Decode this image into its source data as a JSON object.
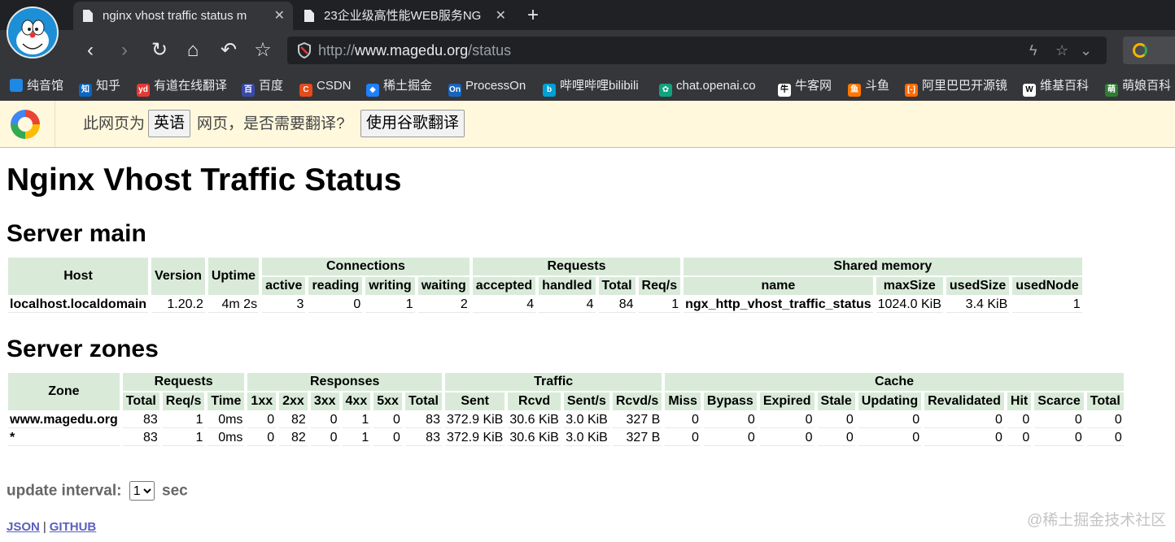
{
  "browser": {
    "tabs": [
      {
        "title": "nginx vhost traffic status m",
        "active": true
      },
      {
        "title": "23企业级高性能WEB服务NG",
        "active": false
      }
    ],
    "new_tab": "+",
    "url_prefix": "http://",
    "url_host": "www.magedu.org",
    "url_path": "/status",
    "bookmarks": [
      {
        "label": "纯音馆",
        "icon": "music-icon",
        "color": "#1e88e5"
      },
      {
        "label": "知乎",
        "icon": "zhihu-icon",
        "color": "#0a66c2",
        "glyph": "知"
      },
      {
        "label": "有道在线翻译",
        "icon": "youdao-icon",
        "color": "#e53935",
        "glyph": "yd"
      },
      {
        "label": "百度",
        "icon": "baidu-icon",
        "color": "#3949ab",
        "glyph": "百"
      },
      {
        "label": "CSDN",
        "icon": "csdn-icon",
        "color": "#e64a19",
        "glyph": "C"
      },
      {
        "label": "稀土掘金",
        "icon": "juejin-icon",
        "color": "#1e80ff",
        "glyph": "◆"
      },
      {
        "label": "ProcessOn",
        "icon": "processon-icon",
        "color": "#1565c0",
        "glyph": "On"
      },
      {
        "label": "哔哩哔哩bilibili",
        "icon": "bilibili-icon",
        "color": "#00a1d6",
        "glyph": "b"
      },
      {
        "label": "chat.openai.co",
        "icon": "openai-icon",
        "color": "#10a37f",
        "glyph": "✿"
      },
      {
        "label": "牛客网",
        "icon": "nowcoder-icon",
        "color": "#ffffff",
        "glyph": "牛"
      },
      {
        "label": "斗鱼",
        "icon": "douyu-icon",
        "color": "#ff7700",
        "glyph": "鱼"
      },
      {
        "label": "阿里巴巴开源镜",
        "icon": "aliyun-icon",
        "color": "#ff6a00",
        "glyph": "[-]"
      },
      {
        "label": "维基百科",
        "icon": "wikipedia-icon",
        "color": "#ffffff",
        "glyph": "W"
      },
      {
        "label": "萌娘百科",
        "icon": "moegirl-icon",
        "color": "#2e7d32",
        "glyph": "萌"
      }
    ],
    "translate_bar": {
      "prefix": "此网页为",
      "language": "英语",
      "suffix": "网页，是否需要翻译?",
      "button": "使用谷歌翻译"
    }
  },
  "page": {
    "title": "Nginx Vhost Traffic Status",
    "server_main": {
      "heading": "Server main",
      "headers": {
        "host": "Host",
        "version": "Version",
        "uptime": "Uptime",
        "connections": "Connections",
        "requests": "Requests",
        "shared_memory": "Shared memory",
        "conn_cols": [
          "active",
          "reading",
          "writing",
          "waiting"
        ],
        "req_cols": [
          "accepted",
          "handled",
          "Total",
          "Req/s"
        ],
        "shm_cols": [
          "name",
          "maxSize",
          "usedSize",
          "usedNode"
        ]
      },
      "row": {
        "host": "localhost.localdomain",
        "version": "1.20.2",
        "uptime": "4m 2s",
        "active": "3",
        "reading": "0",
        "writing": "1",
        "waiting": "2",
        "accepted": "4",
        "handled": "4",
        "total": "84",
        "reqs": "1",
        "shm_name": "ngx_http_vhost_traffic_status",
        "max_size": "1024.0 KiB",
        "used_size": "3.4 KiB",
        "used_node": "1"
      }
    },
    "server_zones": {
      "heading": "Server zones",
      "headers": {
        "zone": "Zone",
        "requests": "Requests",
        "responses": "Responses",
        "traffic": "Traffic",
        "cache": "Cache",
        "req_cols": [
          "Total",
          "Req/s",
          "Time"
        ],
        "resp_cols": [
          "1xx",
          "2xx",
          "3xx",
          "4xx",
          "5xx",
          "Total"
        ],
        "traffic_cols": [
          "Sent",
          "Rcvd",
          "Sent/s",
          "Rcvd/s"
        ],
        "cache_cols": [
          "Miss",
          "Bypass",
          "Expired",
          "Stale",
          "Updating",
          "Revalidated",
          "Hit",
          "Scarce",
          "Total"
        ]
      },
      "rows": [
        {
          "zone": "www.magedu.org",
          "cells": [
            "83",
            "1",
            "0ms",
            "0",
            "82",
            "0",
            "1",
            "0",
            "83",
            "372.9 KiB",
            "30.6 KiB",
            "3.0 KiB",
            "327 B",
            "0",
            "0",
            "0",
            "0",
            "0",
            "0",
            "0",
            "0",
            "0"
          ]
        },
        {
          "zone": "*",
          "cells": [
            "83",
            "1",
            "0ms",
            "0",
            "82",
            "0",
            "1",
            "0",
            "83",
            "372.9 KiB",
            "30.6 KiB",
            "3.0 KiB",
            "327 B",
            "0",
            "0",
            "0",
            "0",
            "0",
            "0",
            "0",
            "0",
            "0"
          ]
        }
      ]
    },
    "update_interval": {
      "label": "update interval:",
      "value": "1",
      "unit": "sec"
    },
    "links": {
      "json": "JSON",
      "sep": "|",
      "github": "GITHUB"
    },
    "watermark": "@稀土掘金技术社区"
  }
}
